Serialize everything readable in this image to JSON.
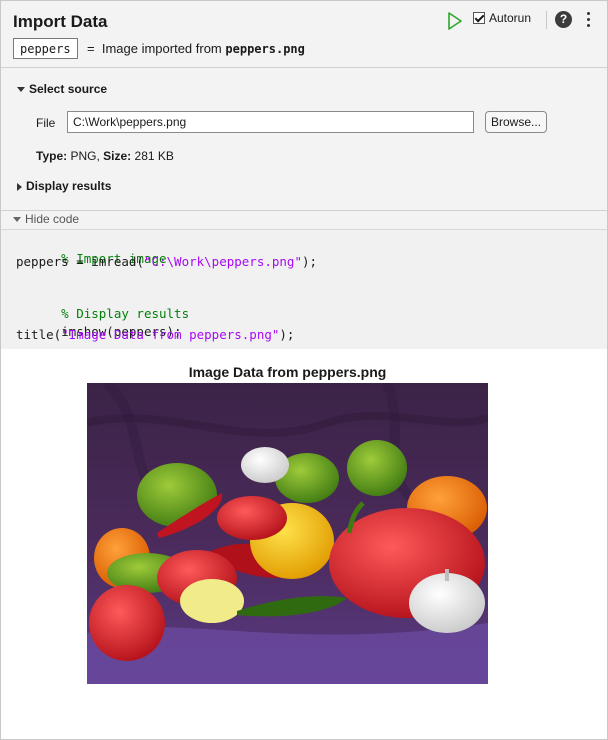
{
  "header": {
    "title": "Import Data",
    "variable_name": "peppers",
    "equals": "=",
    "description_prefix": "Image imported from",
    "description_file": "peppers.png",
    "autorun_label": "Autorun",
    "autorun_checked": true,
    "run_icon": "run-icon",
    "help_icon": "help-icon",
    "help_glyph": "?",
    "more_icon": "more-options-icon"
  },
  "source": {
    "heading": "Select source",
    "file_label": "File",
    "file_value": "C:\\Work\\peppers.png",
    "browse_label": "Browse...",
    "type_label": "Type:",
    "type_value": "PNG,",
    "size_label": "Size:",
    "size_value": "281 KB"
  },
  "display": {
    "heading": "Display results"
  },
  "code": {
    "toggle_label": "Hide code",
    "lines": [
      {
        "comment": "% Import image"
      },
      {
        "pre": "peppers = imread(",
        "str": "\"C:\\Work\\peppers.png\"",
        "post": ");"
      },
      {
        "comment": "% Display results"
      },
      {
        "plain": "imshow(peppers);"
      },
      {
        "pre": "title(",
        "str": "\"Image Data from peppers.png\"",
        "post": ");"
      }
    ]
  },
  "output": {
    "figure_title": "Image Data from peppers.png"
  },
  "colors": {
    "run_green": "#2ba829",
    "comment_green": "#028009",
    "string_purple": "#a709f5"
  }
}
